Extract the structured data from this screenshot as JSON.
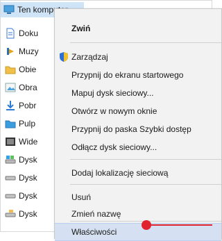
{
  "tree": {
    "root_label": "Ten komputer",
    "items": [
      {
        "label": "Doku",
        "icon": "documents-icon"
      },
      {
        "label": "Muzy",
        "icon": "music-icon"
      },
      {
        "label": "Obie",
        "icon": "objects-3d-icon"
      },
      {
        "label": "Obra",
        "icon": "pictures-icon"
      },
      {
        "label": "Pobr",
        "icon": "downloads-icon"
      },
      {
        "label": "Pulp",
        "icon": "desktop-icon"
      },
      {
        "label": "Wide",
        "icon": "videos-icon"
      },
      {
        "label": "Dysk",
        "icon": "system-drive-icon"
      },
      {
        "label": "Dysk",
        "icon": "drive-icon"
      },
      {
        "label": "Dysk",
        "icon": "drive-icon"
      },
      {
        "label": "Dysk",
        "icon": "network-drive-icon"
      }
    ]
  },
  "context_menu": {
    "collapse": "Zwiń",
    "manage": "Zarządzaj",
    "pin_start": "Przypnij do ekranu startowego",
    "map_drive": "Mapuj dysk sieciowy...",
    "open_new_window": "Otwórz w nowym oknie",
    "pin_quick_access": "Przypnij do paska Szybki dostęp",
    "disconnect_drive": "Odłącz dysk sieciowy...",
    "add_network_location": "Dodaj lokalizację sieciową",
    "delete": "Usuń",
    "rename": "Zmień nazwę",
    "properties": "Właściwości"
  },
  "colors": {
    "annotation": "#e0232e",
    "selection": "#d5e1f2",
    "menu_background": "#f2f2f2"
  }
}
